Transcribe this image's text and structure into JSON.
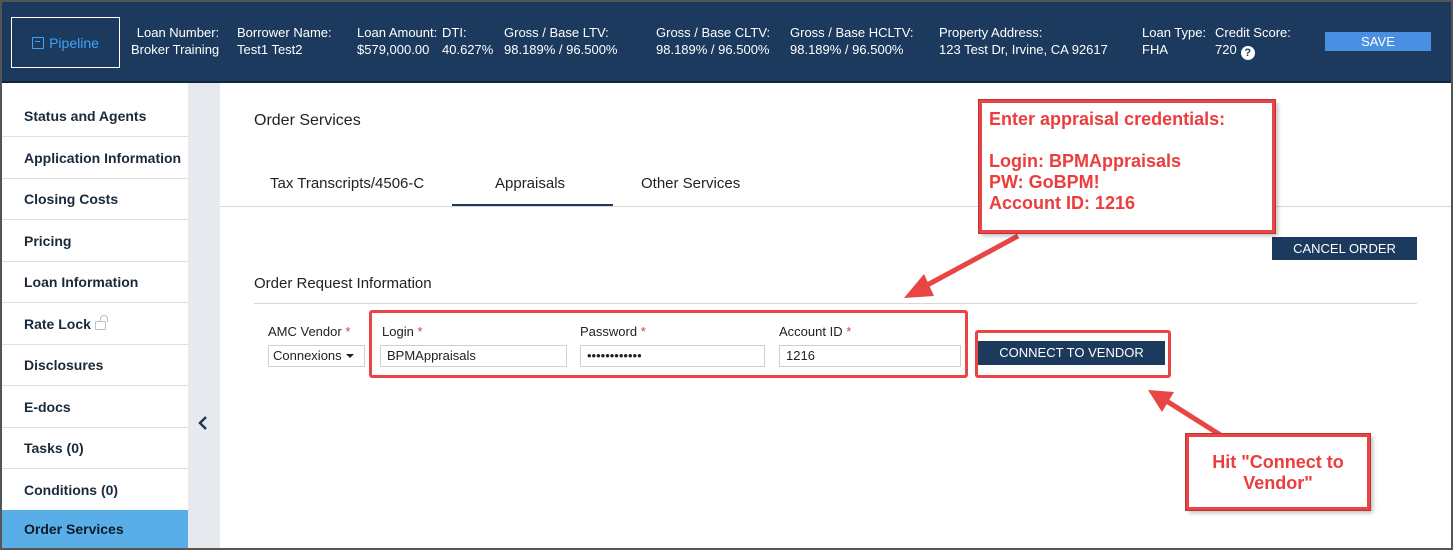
{
  "header": {
    "pipeline_label": "Pipeline",
    "fields": [
      {
        "label": "Loan Number:",
        "value": "Broker Training"
      },
      {
        "label": "Borrower Name:",
        "value": "Test1 Test2"
      },
      {
        "label": "Loan Amount:",
        "value": "$579,000.00"
      },
      {
        "label": "DTI:",
        "value": "40.627%"
      },
      {
        "label": "Gross / Base LTV:",
        "value": "98.189% / 96.500%"
      },
      {
        "label": "Gross / Base CLTV:",
        "value": "98.189% / 96.500%"
      },
      {
        "label": "Gross / Base HCLTV:",
        "value": "98.189% / 96.500%"
      },
      {
        "label": "Property Address:",
        "value": "123 Test Dr, Irvine, CA 92617"
      },
      {
        "label": "Loan Type:",
        "value": "FHA"
      },
      {
        "label": "Credit Score:",
        "value": "720"
      }
    ],
    "help_icon": "?",
    "save_label": "SAVE"
  },
  "sidebar": {
    "items": [
      {
        "label": "Status and Agents"
      },
      {
        "label": "Application Information"
      },
      {
        "label": "Closing Costs"
      },
      {
        "label": "Pricing"
      },
      {
        "label": "Loan Information"
      },
      {
        "label": "Rate Lock"
      },
      {
        "label": "Disclosures"
      },
      {
        "label": "E-docs"
      },
      {
        "label": "Tasks (0)"
      },
      {
        "label": "Conditions (0)"
      },
      {
        "label": "Order Services",
        "active": true
      }
    ]
  },
  "main": {
    "title": "Order Services",
    "tabs": [
      {
        "label": "Tax Transcripts/4506-C"
      },
      {
        "label": "Appraisals",
        "active": true
      },
      {
        "label": "Other Services"
      }
    ],
    "cancel_order_label": "CANCEL ORDER",
    "section_title": "Order Request Information",
    "form": {
      "vendor_label": "AMC Vendor",
      "vendor_value": "Connexions",
      "login_label": "Login",
      "login_value": "BPMAppraisals",
      "password_label": "Password",
      "password_value": "••••••••••••",
      "account_label": "Account ID",
      "account_value": "1216",
      "required_mark": "*"
    },
    "connect_label": "CONNECT TO VENDOR"
  },
  "annotations": {
    "callout_top": {
      "heading": "Enter appraisal credentials:",
      "line1": "Login: BPMAppraisals",
      "line2": "PW: GoBPM!",
      "line3": "Account ID: 1216"
    },
    "callout_bottom": "Hit \"Connect to Vendor\""
  },
  "colors": {
    "header_bg": "#1b3a5e",
    "accent_blue": "#4a90e2",
    "active_nav": "#5aaee8",
    "annotation_red": "#e84545"
  }
}
